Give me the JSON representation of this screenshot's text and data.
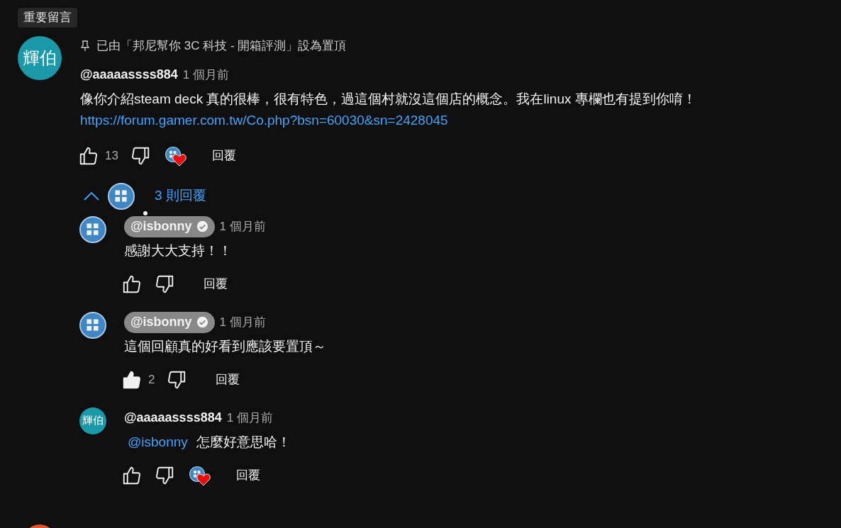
{
  "section_badge": "重要留言",
  "comment": {
    "avatar_text": "輝伯",
    "pinned": "已由「邦尼幫你 3C 科技 - 開箱評測」設為置頂",
    "author": "@aaaaassss884",
    "time": "1 個月前",
    "body": "像你介紹steam deck 真的很棒，很有特色，過這個村就沒這個店的概念。我在linux 專欄也有提到你唷！",
    "link": "https://forum.gamer.com.tw/Co.php?bsn=60030&sn=2428045",
    "liked": false,
    "likes": "13",
    "hearted": true,
    "reply_button": "回覆"
  },
  "replies_toggle": {
    "expanded": true,
    "label": "3 則回覆"
  },
  "replies": [
    {
      "kind": "creator",
      "author": "@isbonny",
      "time": "1 個月前",
      "body": "感謝大大支持！！",
      "liked": false,
      "hearted": false,
      "reply_button": "回覆"
    },
    {
      "kind": "creator",
      "author": "@isbonny",
      "time": "1 個月前",
      "body": "這個回顧真的好看到應該要置頂～",
      "liked": true,
      "likes": "2",
      "hearted": false,
      "reply_button": "回覆"
    },
    {
      "kind": "user",
      "avatar_text": "輝伯",
      "author": "@aaaaassss884",
      "time": "1 個月前",
      "mention": "@isbonny",
      "body": "怎麼好意思哈！",
      "liked": false,
      "hearted": true,
      "reply_button": "回覆"
    }
  ]
}
